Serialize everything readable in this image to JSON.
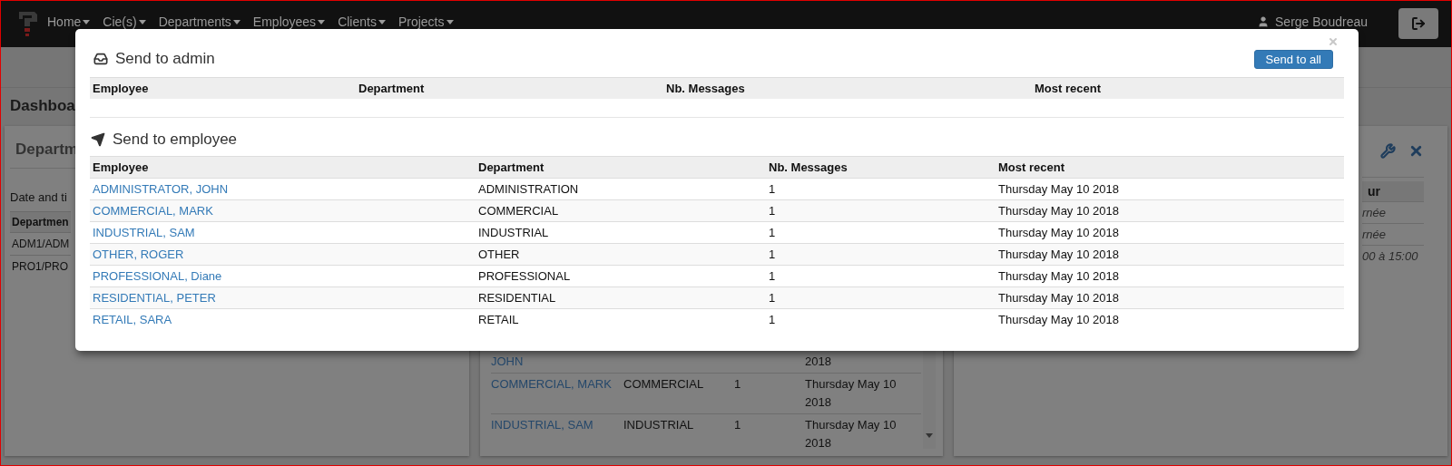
{
  "navbar": {
    "menu": [
      {
        "label": "Home"
      },
      {
        "label": "Cie(s)"
      },
      {
        "label": "Departments"
      },
      {
        "label": "Employees"
      },
      {
        "label": "Clients"
      },
      {
        "label": "Projects"
      }
    ],
    "user": "Serge Boudreau"
  },
  "background": {
    "page_title": "Dashboa",
    "left_panel": {
      "title": "Departm",
      "note": "Date and ti",
      "table_header": "Departmen",
      "rows": [
        "ADM1/ADM",
        "PRO1/PRO"
      ]
    },
    "middle_panel": {
      "rows": [
        {
          "employee": "JOHN",
          "date": "2018"
        },
        {
          "employee": "COMMERCIAL, MARK",
          "department": "COMMERCIAL",
          "messages": "1",
          "date": "Thursday May 10 2018"
        },
        {
          "employee": "INDUSTRIAL, SAM",
          "department": "INDUSTRIAL",
          "messages": "1",
          "date": "Thursday May 10 2018"
        }
      ]
    },
    "right_panel": {
      "table_header": "ur",
      "rows": [
        "rnée",
        "rnée",
        "00 à 15:00"
      ]
    }
  },
  "modal": {
    "admin": {
      "title": "Send to admin",
      "button": "Send to all",
      "columns": [
        "Employee",
        "Department",
        "Nb. Messages",
        "Most recent"
      ]
    },
    "employee": {
      "title": "Send to employee",
      "columns": [
        "Employee",
        "Department",
        "Nb. Messages",
        "Most recent"
      ],
      "rows": [
        {
          "employee": "ADMINISTRATOR, JOHN",
          "department": "ADMINISTRATION",
          "messages": "1",
          "date": "Thursday May 10 2018"
        },
        {
          "employee": "COMMERCIAL, MARK",
          "department": "COMMERCIAL",
          "messages": "1",
          "date": "Thursday May 10 2018"
        },
        {
          "employee": "INDUSTRIAL, SAM",
          "department": "INDUSTRIAL",
          "messages": "1",
          "date": "Thursday May 10 2018"
        },
        {
          "employee": "OTHER, ROGER",
          "department": "OTHER",
          "messages": "1",
          "date": "Thursday May 10 2018"
        },
        {
          "employee": "PROFESSIONAL, Diane",
          "department": "PROFESSIONAL",
          "messages": "1",
          "date": "Thursday May 10 2018"
        },
        {
          "employee": "RESIDENTIAL, PETER",
          "department": "RESIDENTIAL",
          "messages": "1",
          "date": "Thursday May 10 2018"
        },
        {
          "employee": "RETAIL, SARA",
          "department": "RETAIL",
          "messages": "1",
          "date": "Thursday May 10 2018"
        }
      ]
    }
  }
}
